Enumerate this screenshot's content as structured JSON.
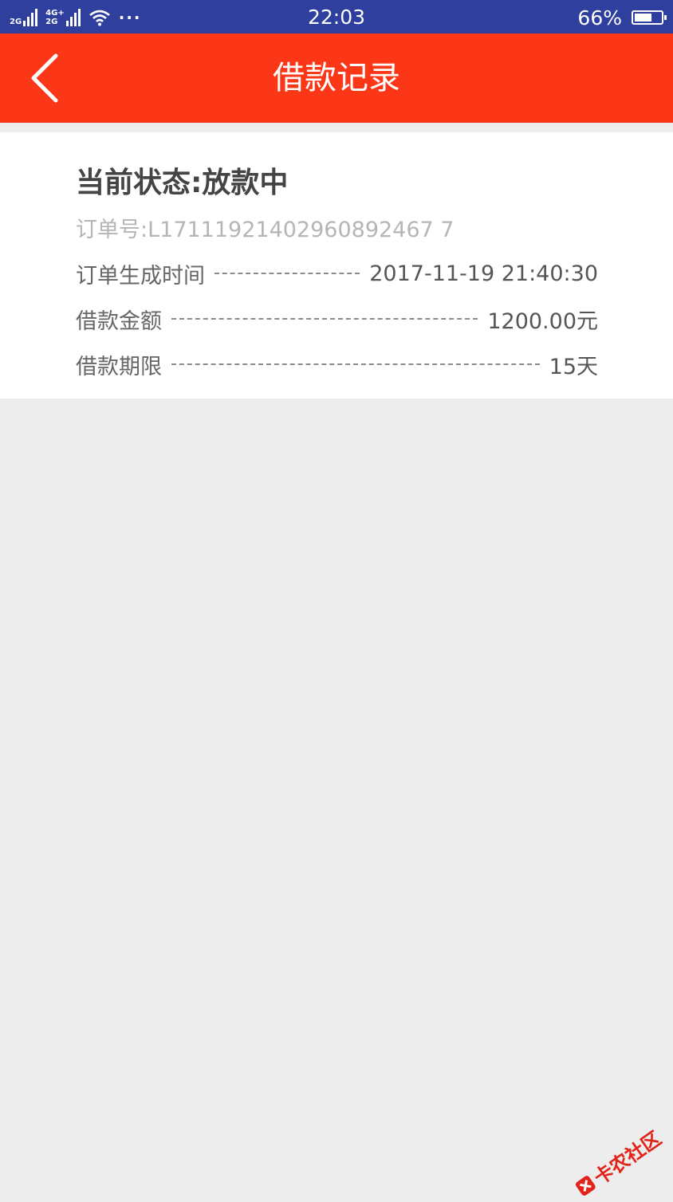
{
  "status_bar": {
    "net1_label": "2G",
    "net2_label_top": "4G+",
    "net2_label_bottom": "2G",
    "time": "22:03",
    "battery": "66%",
    "battery_level": 0.66
  },
  "header": {
    "title": "借款记录"
  },
  "record": {
    "status": "当前状态:放款中",
    "order_label": "订单号:",
    "order_number": "L17111921402960892467 7",
    "rows": [
      {
        "label": "订单生成时间",
        "value": "2017-11-19 21:40:30"
      },
      {
        "label": "借款金额",
        "value": "1200.00元"
      },
      {
        "label": "借款期限",
        "value": "15天"
      }
    ]
  },
  "watermark": {
    "text": "卡农社区"
  }
}
